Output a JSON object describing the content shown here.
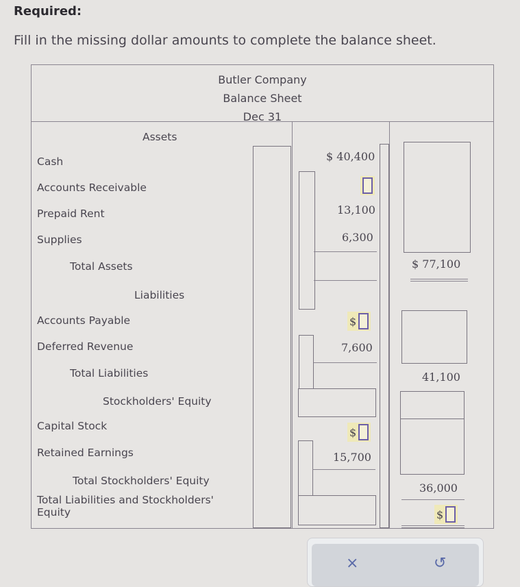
{
  "prompt": {
    "heading": "Required:",
    "instruction": "Fill in the missing dollar amounts to complete the balance sheet."
  },
  "balance_sheet": {
    "company": "Butler Company",
    "title": "Balance Sheet",
    "date": "Dec 31",
    "assets": {
      "section_label": "Assets",
      "items": [
        {
          "label": "Cash",
          "value": "$ 40,400"
        },
        {
          "label": "Accounts Receivable",
          "value": ""
        },
        {
          "label": "Prepaid Rent",
          "value": "13,100"
        },
        {
          "label": "Supplies",
          "value": "6,300"
        }
      ],
      "total_label": "Total Assets",
      "total_value": "$ 77,100"
    },
    "liabilities": {
      "section_label": "Liabilities",
      "items": [
        {
          "label": "Accounts Payable",
          "value": ""
        },
        {
          "label": "Deferred Revenue",
          "value": "7,600"
        }
      ],
      "total_label": "Total Liabilities",
      "total_value": "41,100"
    },
    "equity": {
      "section_label": "Stockholders' Equity",
      "items": [
        {
          "label": "Capital Stock",
          "value": ""
        },
        {
          "label": "Retained Earnings",
          "value": "15,700"
        }
      ],
      "total_label": "Total Stockholders' Equity",
      "total_value": "36,000"
    },
    "grand_total_label": "Total Liabilities and Stockholders' Equity",
    "grand_total_value": "",
    "dollar_sign": "$"
  },
  "actions": {
    "clear_icon": "×",
    "reset_icon": "↺"
  },
  "colors": {
    "input_highlight": "#efe9b8",
    "input_border": "#6c5fa8",
    "action_icon": "#5a6aa8"
  }
}
